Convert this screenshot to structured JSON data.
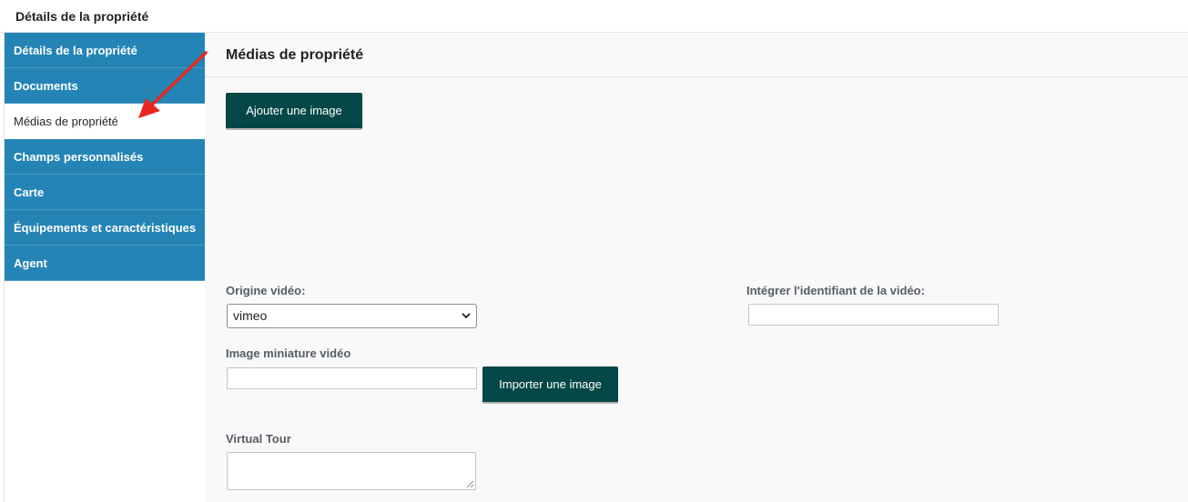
{
  "header": {
    "title": "Détails de la propriété"
  },
  "sidebar": {
    "items": [
      {
        "label": "Détails de la propriété",
        "active": false
      },
      {
        "label": "Documents",
        "active": false
      },
      {
        "label": "Médias de propriété",
        "active": true
      },
      {
        "label": "Champs personnalisés",
        "active": false
      },
      {
        "label": "Carte",
        "active": false
      },
      {
        "label": "Équipements et caractéristiques",
        "active": false
      },
      {
        "label": "Agent",
        "active": false
      }
    ]
  },
  "main": {
    "section_title": "Médias de propriété",
    "add_image_label": "Ajouter une image",
    "video_origin": {
      "label": "Origine vidéo:",
      "value": "vimeo"
    },
    "embed_id": {
      "label": "Intégrer l'identifiant de la vidéo:",
      "value": ""
    },
    "thumbnail": {
      "label": "Image miniature vidéo",
      "value": "",
      "import_label": "Importer une image"
    },
    "virtual_tour": {
      "label": "Virtual Tour",
      "value": ""
    }
  },
  "colors": {
    "sidebar_bg": "#2484b6",
    "button_bg": "#034746",
    "annotation_arrow": "#e8281e"
  },
  "icons": {
    "select_chevron": "chevron-down-icon",
    "annotation": "red-arrow-icon",
    "textarea_grip": "resize-grip-icon"
  }
}
